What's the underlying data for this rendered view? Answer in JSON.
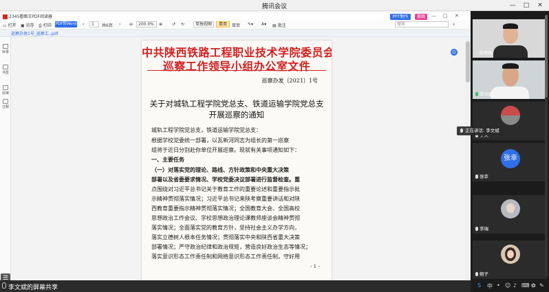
{
  "window": {
    "title": "腾讯会议",
    "minimize": "—",
    "maximize": "□",
    "close": "✕"
  },
  "pdf": {
    "app_title": "2345看图王PDF阅读器",
    "ppt_label": "PPT制作",
    "meitu_label": "美图",
    "win_min": "—",
    "win_max": "□",
    "win_close": "✕",
    "toolbar": {
      "open": "打开",
      "save": "另存",
      "print": "打印",
      "to_word": "PDF转Word",
      "prev": "‹",
      "page_value": "1",
      "page_total": "共6页",
      "next": "›",
      "zoom": "200.0%",
      "rotate_left": "↺",
      "rotate_right": "↻",
      "layout": "单独视图",
      "single": "单页",
      "double": "双页",
      "annotate": "批注",
      "search_placeholder": "搜索"
    },
    "tab": "巡察办发1号_巡察工..pdf",
    "side": {
      "catalog": "目录",
      "bookmark": "书签",
      "read": "阅读",
      "annotation": "注释",
      "menu": "☰"
    }
  },
  "document": {
    "header_line1": "中共陕西铁路工程职业技术学院委员会",
    "header_line2": "巡察工作领导小组办公室文件",
    "doc_number": "巡察办发〔2021〕1号",
    "title_line1": "关于对城轨工程学院党总支、铁道运输学院党总支",
    "title_line2": "开展巡察的通知",
    "paragraphs": [
      "城轨工程学院党总支，铁道运输学院党总支：",
      "    根据学校党委统一部署，以瓦新河同志为组长的第一巡察",
      "组将于近日分别赴你单位开展巡察。现就有关事项通知如下：",
      "    一、主要任务",
      "    （一）对落实党的理论、路线、方针政策和中央重大决策",
      "部署以及省委要求情况、学校党委决议部署进行监督检查。重",
      "点围绕对习近平总书记关于教育工作的重要论述和重要指示批",
      "示精神贯彻落实情况；习近平总书记来陕考察重要讲话和对陕",
      "西教育重要指示精神贯彻落实情况；全国教育大会、全国高校",
      "思想政治工作会议、学校思想政治理论课教师座谈会精神贯彻",
      "落实情况；全面落实党的教育方针，坚持社会主义办学方向，",
      "落实立德树人根本任务情况；贯彻落实中央和陕西省重大决策",
      "部署情况；严守政治纪律和政治规矩，营造良好政治生态等情况；",
      "落实意识形态工作责任制和网络意识形态工作责任制，守好用"
    ],
    "page_number": "- 1 -"
  },
  "status": {
    "sharing_text": "李文斌的屏幕共享"
  },
  "participants": [
    {
      "name": "陈明明",
      "type": "video"
    },
    {
      "name": "李文斌",
      "type": "video",
      "speaking": true
    },
    {
      "name": "丁天",
      "type": "image"
    },
    {
      "name": "张幸",
      "type": "text-avatar",
      "avatar_text": "张幸"
    },
    {
      "name": "李瑞",
      "type": "image"
    },
    {
      "name": "朔子",
      "type": "image"
    }
  ],
  "speaking_tooltip": "正在讲话: 李文斌",
  "tray": {
    "icons": [
      "S",
      "中",
      "•",
      "☺",
      "♪",
      "⌨",
      "✿",
      "✎"
    ]
  },
  "colors": {
    "accent": "#2f6fe8",
    "header_red": "#d21f1f",
    "meitu": "#e84393",
    "avatar_blue": "#2f6fe8"
  }
}
